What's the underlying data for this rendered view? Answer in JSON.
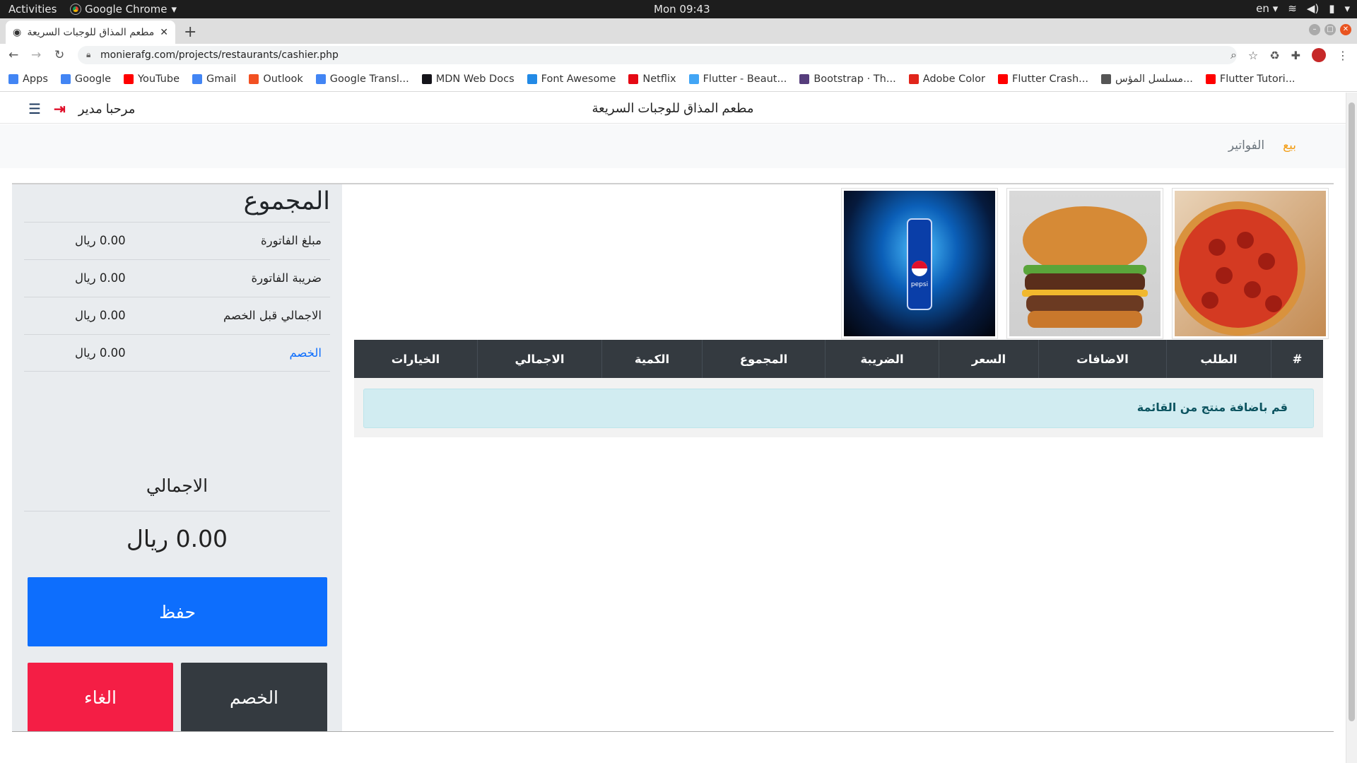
{
  "os": {
    "activities": "Activities",
    "app_name": "Google Chrome",
    "clock": "Mon 09:43",
    "lang": "en"
  },
  "browser": {
    "tab_title": "مطعم المذاق للوجبات السريعة",
    "url": "monierafg.com/projects/restaurants/cashier.php",
    "bookmarks": [
      {
        "label": "Apps",
        "icon": "apps-grid-icon",
        "color": "#4285f4"
      },
      {
        "label": "Google",
        "icon": "google-icon",
        "color": "#4285f4"
      },
      {
        "label": "YouTube",
        "icon": "youtube-icon",
        "color": "#ff0000"
      },
      {
        "label": "Gmail",
        "icon": "google-icon",
        "color": "#4285f4"
      },
      {
        "label": "Outlook",
        "icon": "outlook-icon",
        "color": "#f25022"
      },
      {
        "label": "Google Transl...",
        "icon": "translate-icon",
        "color": "#4285f4"
      },
      {
        "label": "MDN Web Docs",
        "icon": "mdn-icon",
        "color": "#15141a"
      },
      {
        "label": "Font Awesome",
        "icon": "font-awesome-icon",
        "color": "#228ae6"
      },
      {
        "label": "Netflix",
        "icon": "netflix-icon",
        "color": "#e50914"
      },
      {
        "label": "Flutter - Beaut...",
        "icon": "flutter-icon",
        "color": "#42a5f5"
      },
      {
        "label": "Bootstrap · Th...",
        "icon": "bootstrap-icon",
        "color": "#563d7c"
      },
      {
        "label": "Adobe Color",
        "icon": "adobe-icon",
        "color": "#e1251b"
      },
      {
        "label": "Flutter Crash...",
        "icon": "youtube-icon",
        "color": "#ff0000"
      },
      {
        "label": "مسلسل المؤس...",
        "icon": "globe-icon",
        "color": "#555555"
      },
      {
        "label": "Flutter Tutori...",
        "icon": "youtube-icon",
        "color": "#ff0000"
      }
    ]
  },
  "site": {
    "title": "مطعم المذاق للوجبات السريعة",
    "greeting": "مرحبا مدير",
    "nav_sell": "بيع",
    "nav_invoices": "الفواتير"
  },
  "totals": {
    "heading": "المجموع",
    "rows": [
      {
        "label": "مبلغ الفاتورة",
        "value": "0.00 ريال"
      },
      {
        "label": "ضريبة الفاتورة",
        "value": "0.00 ريال"
      },
      {
        "label": "الاجمالي قبل الخصم",
        "value": "0.00 ريال"
      },
      {
        "label": "الخصم",
        "value": "0.00 ريال"
      }
    ],
    "grand_label": "الاجمالي",
    "grand_value": "0.00 ريال",
    "save_label": "حفظ",
    "cancel_label": "الغاء",
    "discount_label": "الخصم"
  },
  "products": [
    {
      "name": "pizza",
      "icon": "pizza-image"
    },
    {
      "name": "burger",
      "icon": "burger-image"
    },
    {
      "name": "pepsi",
      "icon": "pepsi-can-image",
      "can_text": "pepsi"
    }
  ],
  "table": {
    "headers": [
      "#",
      "الطلب",
      "الاضافات",
      "السعر",
      "الضريبة",
      "المجموع",
      "الكمية",
      "الاجمالي",
      "الخيارات"
    ],
    "empty_message": "قم باضافة منتج من القائمة"
  },
  "colors": {
    "primary": "#0d6efd",
    "danger": "#f41e45",
    "dark": "#343a40",
    "sell_link": "#f39c12"
  }
}
